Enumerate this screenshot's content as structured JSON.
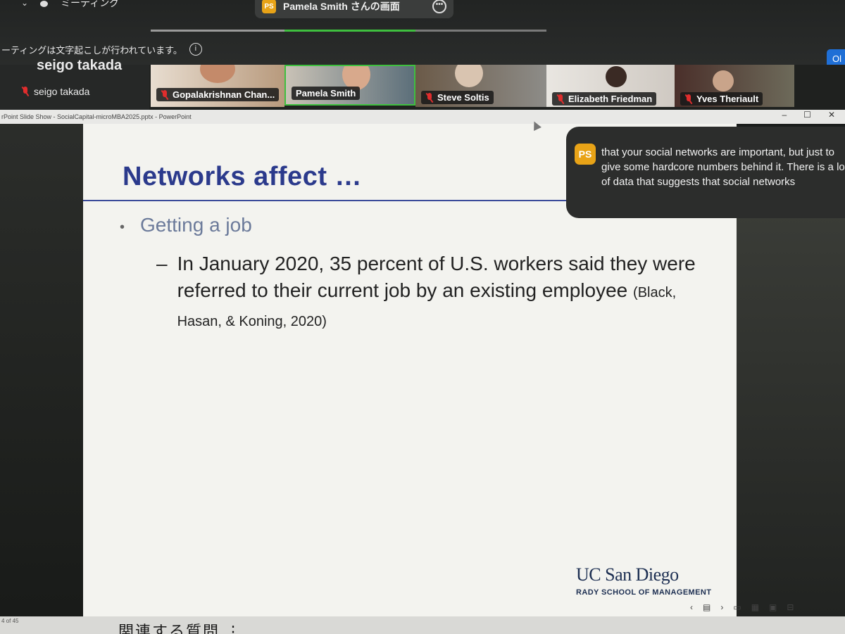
{
  "zoom": {
    "meeting_menu_label": "ミーティング",
    "share_banner": {
      "avatar": "PS",
      "text": "Pamela Smith さんの画面"
    },
    "transcript_notice": "ーティングは文字起こしが行われています。",
    "blue_button_label": "Ol",
    "self_view": {
      "big_name": "seigo takada",
      "name": "seigo takada"
    },
    "participants": [
      {
        "name": "Gopalakrishnan Chan...",
        "muted": true
      },
      {
        "name": "Pamela Smith",
        "muted": false,
        "active": true
      },
      {
        "name": "Steve Soltis",
        "muted": true
      },
      {
        "name": "Elizabeth Friedman",
        "muted": true
      },
      {
        "name": "Yves Theriault",
        "muted": true
      }
    ],
    "caption": {
      "avatar": "PS",
      "text": "that your social networks are important, but just to give some hardcore numbers behind it. There is a lot of data that suggests that social networks"
    },
    "accent_color": "#e8a317",
    "active_speaker_color": "#3fbf3f"
  },
  "powerpoint": {
    "window_title": "rPoint Slide Show  -  SocialCapital-microMBA2025.pptx  -  PowerPoint",
    "status_text": "4 of 45"
  },
  "slide": {
    "title": "Networks affect …",
    "bullet": "Getting a job",
    "sub_bullet_dash": "–",
    "sub_bullet": "In January 2020, 35 percent of U.S. workers said they were referred to their current job by an existing employee",
    "citation": "(Black, Hasan, & Koning, 2020)",
    "logo_main": "UC San Diego",
    "logo_sub": "RADY SCHOOL OF MANAGEMENT",
    "title_color": "#2b3a8c"
  },
  "bottom_overlay_text": "関連する質問  ⋮"
}
